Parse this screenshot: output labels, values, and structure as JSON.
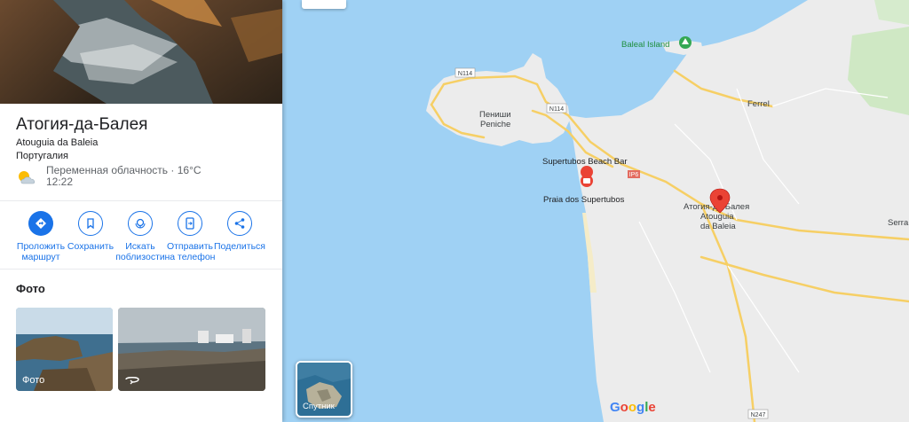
{
  "place": {
    "title": "Атогия-да-Балея",
    "native_name": "Atouguia da Baleia",
    "country": "Португалия",
    "weather_text": "Переменная облачность · 16°C",
    "weather_time": "12:22"
  },
  "actions": [
    {
      "label_1": "Проложить",
      "label_2": "маршрут",
      "icon": "directions-icon"
    },
    {
      "label_1": "Сохранить",
      "label_2": "",
      "icon": "bookmark-icon"
    },
    {
      "label_1": "Искать",
      "label_2": "поблизости",
      "icon": "nearby-icon"
    },
    {
      "label_1": "Отправить",
      "label_2": "на телефон",
      "icon": "send-to-phone-icon"
    },
    {
      "label_1": "Поделиться",
      "label_2": "",
      "icon": "share-icon"
    }
  ],
  "photos": {
    "heading": "Фото",
    "first_label": "Фото",
    "second_icon": "360-icon"
  },
  "map": {
    "labels": {
      "baleal": "Baleal Island",
      "ferrel": "Ferrel",
      "peniche_ru": "Пениши",
      "peniche": "Peniche",
      "supertubos_bar": "Supertubos Beach Bar",
      "praia": "Praia dos Supertubos",
      "atouguia_ru": "Атогия-да-Балея",
      "atouguia_1": "Atouguia",
      "atouguia_2": "da Baleia",
      "serra": "Serra"
    },
    "roads": {
      "n114_a": "N114",
      "n114_b": "N114",
      "ip6": "IP6",
      "n247": "N247"
    },
    "satellite_label": "Спутник",
    "google": [
      "G",
      "o",
      "o",
      "g",
      "l",
      "e"
    ],
    "colors": {
      "water": "#a3d3f5",
      "land": "#ececec",
      "road": "#f9d77d",
      "pin": "#ea4335",
      "park": "#34a853",
      "accent": "#1a73e8"
    }
  }
}
